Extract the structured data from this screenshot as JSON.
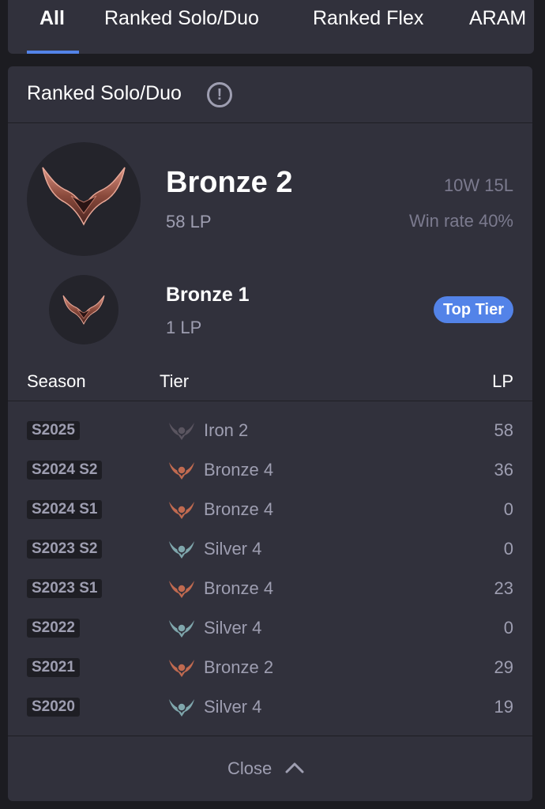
{
  "tabs": [
    {
      "label": "All",
      "active": true
    },
    {
      "label": "Ranked Solo/Duo",
      "active": false
    },
    {
      "label": "Ranked Flex",
      "active": false
    },
    {
      "label": "ARAM",
      "active": false
    }
  ],
  "card": {
    "title": "Ranked Solo/Duo",
    "info_symbol": "!"
  },
  "current_rank": {
    "tier": "Bronze 2",
    "lp": "58 LP",
    "record": "10W 15L",
    "win_rate": "Win rate 40%",
    "emblem": "bronze-emblem-icon"
  },
  "peak_rank": {
    "tier": "Bronze 1",
    "lp": "1 LP",
    "badge": "Top Tier",
    "emblem": "bronze-emblem-icon"
  },
  "history": {
    "headers": {
      "season": "Season",
      "tier": "Tier",
      "lp": "LP"
    },
    "rows": [
      {
        "season": "S2025",
        "tier": "Iron 2",
        "lp": "58",
        "icon": "iron-tier-icon"
      },
      {
        "season": "S2024 S2",
        "tier": "Bronze 4",
        "lp": "36",
        "icon": "bronze-tier-icon"
      },
      {
        "season": "S2024 S1",
        "tier": "Bronze 4",
        "lp": "0",
        "icon": "bronze-tier-icon"
      },
      {
        "season": "S2023 S2",
        "tier": "Silver 4",
        "lp": "0",
        "icon": "silver-tier-icon"
      },
      {
        "season": "S2023 S1",
        "tier": "Bronze 4",
        "lp": "23",
        "icon": "bronze-tier-icon"
      },
      {
        "season": "S2022",
        "tier": "Silver 4",
        "lp": "0",
        "icon": "silver-tier-icon"
      },
      {
        "season": "S2021",
        "tier": "Bronze 2",
        "lp": "29",
        "icon": "bronze-tier-icon"
      },
      {
        "season": "S2020",
        "tier": "Silver 4",
        "lp": "19",
        "icon": "silver-tier-icon"
      }
    ]
  },
  "footer": {
    "close_label": "Close",
    "chevron": "chevron-up-icon"
  },
  "colors": {
    "background": "#1c1c21",
    "panel": "#31313c",
    "accent": "#5383e8",
    "muted_text": "#9e9eb1",
    "iron": "#5a5560",
    "bronze": "#c06a50",
    "silver": "#7fa6ac"
  }
}
